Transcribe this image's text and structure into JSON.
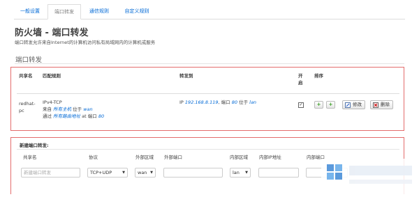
{
  "tabs": [
    {
      "label": "一般设置",
      "active": false
    },
    {
      "label": "端口转发",
      "active": true
    },
    {
      "label": "通信规则",
      "active": false
    },
    {
      "label": "自定义规则",
      "active": false
    }
  ],
  "page": {
    "title": "防火墙 - 端口转发",
    "description": "端口转发允许来自Internet的计算机访问私有局域网内的计算机或服务"
  },
  "section": {
    "title": "端口转发"
  },
  "table": {
    "headers": {
      "name": "共享名",
      "match": "匹配规则",
      "forward_to": "转发到",
      "enable": "开启",
      "sort": "排序"
    },
    "row": {
      "name": "redhat-pc",
      "protocol": "IPv4-TCP",
      "from_prefix": "来自",
      "from_value": "所有主机",
      "from_zone_prefix": "位于",
      "from_zone": "wan",
      "via_prefix": "通过",
      "via_value": "所有路由地址",
      "via_port_prefix": "at 端口",
      "via_port": "80",
      "forward_prefix": "IP",
      "forward_ip": "192.168.8.119",
      "forward_port_prefix": ", 端口",
      "forward_port": "80",
      "forward_zone_prefix": "位于",
      "forward_zone": "lan",
      "enabled": true,
      "edit_label": "修改",
      "delete_label": "删除"
    }
  },
  "new_rule": {
    "title": "新建端口转发:",
    "headers": {
      "name": "共享名",
      "protocol": "协议",
      "ext_zone": "外部区域",
      "ext_port": "外部端口",
      "int_zone": "内部区域",
      "int_ip": "内部IP地址",
      "int_port": "内部端口"
    },
    "name_placeholder": "新建端口转发",
    "protocol_value": "TCP+UDP",
    "ext_zone_value": "wan",
    "ext_port_value": "",
    "int_zone_value": "lan",
    "int_ip_value": "",
    "int_port_value": ""
  },
  "colors": {
    "link": "#0069d6",
    "highlight_box": "#e36c6c",
    "green_button": "#3a9d23"
  },
  "icons": {
    "move_up": "plus-icon",
    "move_down": "plus-icon",
    "edit": "edit-icon",
    "delete": "delete-icon",
    "select_arrow": "chevron-down-icon"
  }
}
